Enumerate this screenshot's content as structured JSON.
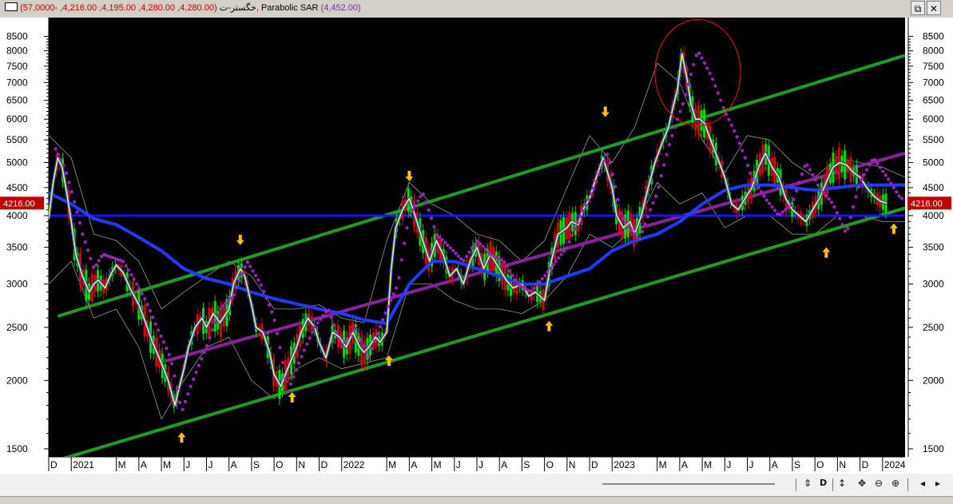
{
  "window": {
    "symbol": "خگستر-ت",
    "ohlc": "(4,280.00, 4,280.00, 4,195.00, 4,216.00, -57.0000),",
    "indicator_name": "Parabolic SAR",
    "indicator_value": "(4,452.00)",
    "restore_icon": "restore-icon",
    "close_icon": "close-icon"
  },
  "colors": {
    "background": "#000000",
    "axis_bg": "#ffffff",
    "green_channel": "#1e9e1e",
    "purple_trend": "#8b1f9e",
    "blue_level": "#1414ff",
    "blue_ma": "#1c3cff",
    "price_yellow": "#ffff00",
    "sar_dots": "#a020c0",
    "marker_arrow": "#ffc000",
    "highlight_circle": "#d01010",
    "last_price_tag": "#c00000"
  },
  "toolbar": {
    "icons": [
      "sync-icon",
      "D",
      "vertical-zoom-icon",
      "pan-icon",
      "zoom-out-icon",
      "zoom-in-icon",
      "scroll-left-icon",
      "scroll-right-icon"
    ]
  },
  "chart_data": {
    "type": "line",
    "y_scale": "log",
    "ylim": [
      1450,
      9200
    ],
    "y_ticks": [
      1500,
      2000,
      2500,
      3000,
      3500,
      4000,
      4500,
      5000,
      5500,
      6000,
      6500,
      7000,
      7500,
      8000,
      8500
    ],
    "y_tick_labels": [
      "1500",
      "2000",
      "2500",
      "3000",
      "3500",
      "4000",
      "4500",
      "5000",
      "5500",
      "6000",
      "6500",
      "7000",
      "7500",
      "8000",
      "8500"
    ],
    "x_labels": [
      "D",
      "2021",
      "M",
      "A",
      "M",
      "J",
      "J",
      "A",
      "S",
      "O",
      "N",
      "D",
      "2022",
      "M",
      "A",
      "M",
      "J",
      "J",
      "A",
      "S",
      "O",
      "N",
      "D",
      "2023",
      "M",
      "A",
      "M",
      "J",
      "J",
      "A",
      "S",
      "O",
      "N",
      "D",
      "2024"
    ],
    "x_label_pos": [
      0,
      1,
      3,
      4,
      5,
      6,
      7,
      8,
      9,
      10,
      11,
      12,
      13,
      15,
      16,
      17,
      18,
      19,
      20,
      21,
      22,
      23,
      24,
      25,
      27,
      28,
      29,
      30,
      31,
      32,
      33,
      34,
      35,
      36,
      37
    ],
    "last_price": "4216.00",
    "price_series": {
      "x": [
        0,
        0.2,
        0.4,
        0.6,
        0.8,
        1,
        1.2,
        1.5,
        1.8,
        2,
        2.2,
        2.5,
        2.8,
        3,
        3.3,
        3.6,
        4,
        4.3,
        4.6,
        5,
        5.3,
        5.6,
        5.8,
        6,
        6.2,
        6.5,
        6.8,
        7,
        7.3,
        7.6,
        8,
        8.2,
        8.5,
        8.7,
        9,
        9.2,
        9.5,
        9.8,
        10,
        10.3,
        10.6,
        11,
        11.2,
        11.5,
        11.8,
        12,
        12.3,
        12.6,
        12.9,
        13.2,
        13.5,
        13.8,
        14,
        14.2,
        14.5,
        14.7,
        15,
        15.2,
        15.4,
        15.7,
        16,
        16.3,
        16.6,
        16.9,
        17.2,
        17.5,
        17.8,
        18.1,
        18.4,
        18.7,
        19,
        19.3,
        19.6,
        20,
        20.3,
        20.6,
        21,
        21.3,
        21.6,
        22,
        22.3,
        22.6,
        23,
        23.2,
        23.5,
        23.7,
        24,
        24.3,
        24.6,
        25,
        25.2,
        25.5,
        25.8,
        26,
        26.3,
        26.6,
        26.9,
        27.2,
        27.5,
        27.7,
        27.9,
        28.1,
        28.3,
        28.5,
        28.7,
        28.9,
        29.1,
        29.3,
        29.6,
        30,
        30.3,
        30.6,
        30.9,
        31.2,
        31.5,
        31.8,
        32.1,
        32.4,
        32.7,
        33,
        33.3,
        33.6,
        33.9,
        34.2,
        34.5,
        34.8,
        35.1,
        35.4,
        35.7,
        36,
        36.3,
        36.6,
        36.9,
        37.2,
        37.5,
        37.8,
        38
      ],
      "y": [
        3950,
        4600,
        5100,
        4900,
        4400,
        3900,
        3400,
        3100,
        2900,
        3000,
        3050,
        2950,
        3150,
        3250,
        3150,
        2950,
        2750,
        2550,
        2350,
        2150,
        2000,
        1800,
        1950,
        2100,
        2300,
        2500,
        2600,
        2500,
        2650,
        2550,
        2700,
        3000,
        3200,
        3100,
        2750,
        2500,
        2450,
        2250,
        2050,
        1950,
        2100,
        2300,
        2450,
        2600,
        2500,
        2350,
        2200,
        2450,
        2400,
        2300,
        2450,
        2300,
        2250,
        2300,
        2400,
        2350,
        2450,
        3200,
        3800,
        4100,
        4300,
        3950,
        3600,
        3300,
        3600,
        3400,
        3100,
        3200,
        3000,
        3300,
        3500,
        3200,
        3400,
        3200,
        3050,
        2950,
        3000,
        2850,
        2900,
        2800,
        3300,
        3700,
        3800,
        3900,
        3850,
        4100,
        4300,
        4700,
        5100,
        4500,
        4000,
        3800,
        3900,
        3700,
        4000,
        4500,
        5000,
        5400,
        5800,
        6300,
        6800,
        7900,
        7200,
        6400,
        6000,
        6000,
        5900,
        5600,
        5200,
        4700,
        4200,
        4100,
        4300,
        4500,
        4900,
        5200,
        4900,
        4700,
        4300,
        4100,
        4000,
        3900,
        4100,
        4300,
        4600,
        4900,
        5000,
        4950,
        4800,
        4700,
        4500,
        4350,
        4250,
        4216
      ]
    },
    "sar_series": {
      "x": [
        0.3,
        0.7,
        1.1,
        1.5,
        2,
        2.4,
        3.3,
        3.7,
        4.3,
        4.8,
        5.4,
        5.9,
        6.4,
        7,
        7.6,
        8.2,
        8.8,
        9.4,
        10,
        10.6,
        11.2,
        11.8,
        12.4,
        13,
        13.6,
        14.2,
        15.5,
        16,
        16.6,
        17.2,
        17.8,
        18.4,
        19,
        19.6,
        20.2,
        20.8,
        21.4,
        22,
        23,
        23.6,
        24.2,
        24.8,
        25.4,
        26.2,
        27,
        27.6,
        28.2,
        28.8,
        29.4,
        30,
        30.6,
        31.2,
        31.8,
        32.4,
        33,
        33.6,
        34.2,
        34.8,
        35.4,
        36,
        36.6,
        37.2,
        37.8
      ],
      "y": [
        5300,
        4900,
        4300,
        3700,
        3200,
        3400,
        3300,
        3100,
        2800,
        2500,
        2200,
        1750,
        2000,
        2300,
        2700,
        2850,
        3300,
        3000,
        2600,
        1900,
        2200,
        2500,
        2700,
        2300,
        2500,
        2200,
        3000,
        4000,
        4400,
        3700,
        3500,
        3300,
        3600,
        3400,
        3300,
        3000,
        2900,
        3100,
        3500,
        4000,
        4500,
        5200,
        4000,
        3600,
        4400,
        5500,
        6500,
        8000,
        7200,
        6200,
        5500,
        4700,
        4300,
        4000,
        4200,
        5000,
        4500,
        4200,
        3700,
        4600,
        5100,
        4700,
        4300
      ]
    },
    "ma_series": {
      "x": [
        0,
        1,
        2,
        3,
        4,
        5,
        6,
        7,
        8,
        9,
        10,
        11,
        12,
        13,
        14,
        15,
        16,
        17,
        18,
        19,
        20,
        21,
        22,
        23,
        24,
        25,
        26,
        27,
        28,
        29,
        30,
        31,
        32,
        33,
        34,
        35,
        36,
        37,
        38
      ],
      "y": [
        4400,
        4200,
        3950,
        3850,
        3650,
        3450,
        3200,
        3070,
        3000,
        2900,
        2820,
        2760,
        2700,
        2650,
        2580,
        2540,
        3000,
        3300,
        3300,
        3200,
        3100,
        3000,
        3000,
        3100,
        3200,
        3450,
        3600,
        3700,
        3900,
        4200,
        4450,
        4550,
        4550,
        4500,
        4450,
        4500,
        4550,
        4550,
        4550
      ]
    },
    "envelope_upper": {
      "x": [
        0,
        1,
        2,
        3,
        4,
        5,
        6,
        7,
        8,
        9,
        10,
        11,
        12,
        13,
        14,
        15,
        16,
        17,
        18,
        19,
        20,
        21,
        22,
        23,
        24,
        25,
        26,
        27,
        28,
        29,
        30,
        31,
        32,
        33,
        34,
        35,
        36,
        37,
        38
      ],
      "y": [
        5600,
        5100,
        3700,
        3600,
        3300,
        2700,
        2900,
        3100,
        3300,
        3100,
        2700,
        2700,
        2750,
        2600,
        2550,
        3600,
        4600,
        4200,
        4000,
        3700,
        3600,
        3300,
        3600,
        4500,
        5600,
        5000,
        5800,
        7600,
        7000,
        5500,
        4800,
        5600,
        5500,
        5000,
        4700,
        5100,
        5000,
        4900,
        4700
      ]
    },
    "envelope_lower": {
      "x": [
        0,
        1,
        2,
        3,
        4,
        5,
        6,
        7,
        8,
        9,
        10,
        11,
        12,
        13,
        14,
        15,
        16,
        17,
        18,
        19,
        20,
        21,
        22,
        23,
        24,
        25,
        26,
        27,
        28,
        29,
        30,
        31,
        32,
        33,
        34,
        35,
        36,
        37,
        38
      ],
      "y": [
        3000,
        3300,
        2600,
        2700,
        2300,
        1700,
        2000,
        2300,
        2400,
        2000,
        1850,
        2100,
        2200,
        2100,
        2150,
        2200,
        3000,
        3000,
        2800,
        2700,
        2700,
        2650,
        2800,
        3100,
        3700,
        3500,
        3800,
        4600,
        4200,
        4400,
        3800,
        4000,
        4000,
        3700,
        3700,
        4000,
        4000,
        3900,
        3900
      ]
    },
    "trend_lines": [
      {
        "name": "upper-channel",
        "x": [
          0.4,
          38
        ],
        "y": [
          2620,
          7850
        ],
        "color": "#1e9e1e"
      },
      {
        "name": "lower-channel",
        "x": [
          0.4,
          38
        ],
        "y": [
          1430,
          4130
        ],
        "color": "#1e9e1e"
      },
      {
        "name": "mid-trend",
        "x": [
          5.2,
          38
        ],
        "y": [
          2170,
          5200
        ],
        "color": "#8b1f9e"
      },
      {
        "name": "horizontal-level",
        "x": [
          0,
          38
        ],
        "y": [
          4000,
          4000
        ],
        "color": "#1414ff"
      }
    ],
    "up_arrows": [
      {
        "x": 5.9,
        "y": 1570
      },
      {
        "x": 10.8,
        "y": 1860
      },
      {
        "x": 15.1,
        "y": 2170
      },
      {
        "x": 22.2,
        "y": 2510
      },
      {
        "x": 34.5,
        "y": 3420
      },
      {
        "x": 37.5,
        "y": 3780
      }
    ],
    "down_arrows": [
      {
        "x": 8.5,
        "y": 3620
      },
      {
        "x": 16.0,
        "y": 4730
      },
      {
        "x": 24.7,
        "y": 6200
      }
    ],
    "highlight_ellipse": {
      "cx": 28.8,
      "cy": 7300,
      "rx_months": 1.9,
      "ry_ratio": 1.25
    }
  }
}
